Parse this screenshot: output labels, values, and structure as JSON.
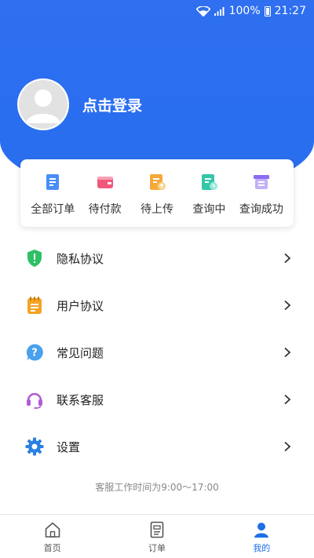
{
  "status_bar": {
    "battery_percent": "100%",
    "time": "21:27"
  },
  "profile": {
    "login_text": "点击登录"
  },
  "orders": [
    {
      "label": "全部订单",
      "icon": "all-orders-icon",
      "color": "#4a8ef5"
    },
    {
      "label": "待付款",
      "icon": "wallet-icon",
      "color": "#f0587a"
    },
    {
      "label": "待上传",
      "icon": "upload-doc-icon",
      "color": "#f6a93b"
    },
    {
      "label": "查询中",
      "icon": "querying-doc-icon",
      "color": "#34c6a8"
    },
    {
      "label": "查询成功",
      "icon": "success-box-icon",
      "color": "#a98af5"
    }
  ],
  "menu": [
    {
      "label": "隐私协议",
      "icon": "shield-icon",
      "color": "#2fc065"
    },
    {
      "label": "用户协议",
      "icon": "notebook-icon",
      "color": "#f3a424"
    },
    {
      "label": "常见问题",
      "icon": "question-icon",
      "color": "#4aa0ec"
    },
    {
      "label": "联系客服",
      "icon": "headset-icon",
      "color": "#b05ad6"
    },
    {
      "label": "设置",
      "icon": "gear-icon",
      "color": "#2a80e0"
    }
  ],
  "service_time": "客服工作时间为9:00～17:00",
  "tabs": [
    {
      "label": "首页",
      "icon": "home-icon",
      "active": false
    },
    {
      "label": "订单",
      "icon": "order-list-icon",
      "active": false
    },
    {
      "label": "我的",
      "icon": "user-icon",
      "active": true
    }
  ],
  "colors": {
    "brand": "#2b6ff0",
    "active_tab": "#1f6fe5"
  }
}
